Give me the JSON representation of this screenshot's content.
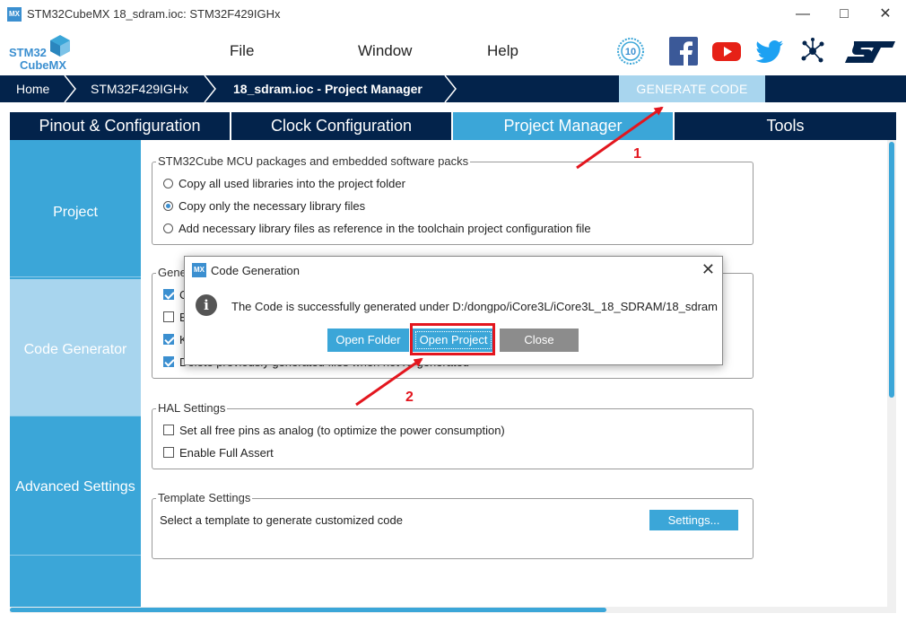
{
  "window": {
    "title": "STM32CubeMX 18_sdram.ioc: STM32F429IGHx",
    "app_icon": "MX",
    "controls": [
      "minimize-icon",
      "maximize-icon",
      "close-icon"
    ]
  },
  "logo": {
    "line1": "STM32",
    "line2": "CubeMX"
  },
  "menu": {
    "file": "File",
    "window": "Window",
    "help": "Help"
  },
  "social_icons": [
    "anniversary-10-badge-icon",
    "facebook-icon",
    "youtube-icon",
    "twitter-icon",
    "network-share-icon",
    "st-logo-icon"
  ],
  "breadcrumb": {
    "home": "Home",
    "device": "STM32F429IGHx",
    "current": "18_sdram.ioc - Project Manager"
  },
  "generate_button": "GENERATE CODE",
  "tabs": [
    {
      "label": "Pinout & Configuration",
      "active": false
    },
    {
      "label": "Clock Configuration",
      "active": false
    },
    {
      "label": "Project Manager",
      "active": true
    },
    {
      "label": "Tools",
      "active": false
    }
  ],
  "sidebar": {
    "items": [
      {
        "label": "Project",
        "active": false
      },
      {
        "label": "Code Generator",
        "active": true
      },
      {
        "label": "Advanced Settings",
        "active": false
      }
    ]
  },
  "packages": {
    "legend": "STM32Cube MCU packages and embedded software packs",
    "options": [
      {
        "label": "Copy all used libraries into the project folder",
        "selected": false
      },
      {
        "label": "Copy only the necessary library files",
        "selected": true
      },
      {
        "label": "Add necessary library files as reference in the toolchain project configuration file",
        "selected": false
      }
    ]
  },
  "generated_files": {
    "legend": "Gene",
    "options": [
      {
        "label": "C",
        "checked": true
      },
      {
        "label": "B",
        "checked": false
      },
      {
        "label": "K",
        "checked": true
      },
      {
        "label": "Delete previously generated files when not re-generated",
        "checked": true
      }
    ]
  },
  "hal": {
    "legend": "HAL Settings",
    "options": [
      {
        "label": "Set all free pins as analog (to optimize the power consumption)",
        "checked": false
      },
      {
        "label": "Enable Full Assert",
        "checked": false
      }
    ]
  },
  "template": {
    "legend": "Template Settings",
    "description": "Select a template to generate customized code",
    "button": "Settings..."
  },
  "dialog": {
    "title": "Code Generation",
    "message": "The Code is successfully generated under D:/dongpo/iCore3L/iCore3L_18_SDRAM/18_sdram",
    "open_folder": "Open Folder",
    "open_project": "Open Project",
    "close": "Close"
  },
  "annotations": {
    "marker1": "1",
    "marker2": "2",
    "color": "#e3161e"
  },
  "colors": {
    "navy": "#03234b",
    "accent": "#3ba6d8",
    "light_accent": "#a8d5ee"
  }
}
